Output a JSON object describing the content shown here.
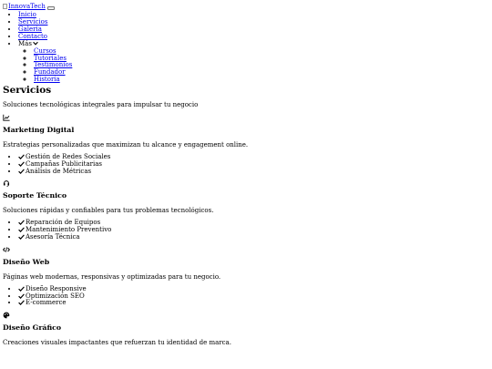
{
  "header": {
    "logo_alt": "InnovaTech"
  },
  "nav": {
    "items": [
      "Inicio",
      "Servicios",
      "Galeria",
      "Contacto"
    ],
    "more_label": "Más",
    "more_items": [
      "Cursos",
      "Tutoriales",
      "Testimonios",
      "Fundador",
      "Historia"
    ]
  },
  "main": {
    "title": "Servicios",
    "subtitle": "Soluciones tecnológicas integrales para impulsar tu negocio",
    "services": [
      {
        "icon": "chart-line-icon",
        "title": "Marketing Digital",
        "description": "Estrategias personalizadas que maximizan tu alcance y engagement online.",
        "features": [
          "Gestión de Redes Sociales",
          "Campañas Publicitarias",
          "Análisis de Métricas"
        ]
      },
      {
        "icon": "headset-icon",
        "title": "Soporte Técnico",
        "description": "Soluciones rápidas y confiables para tus problemas tecnológicos.",
        "features": [
          "Reparación de Equipos",
          "Mantenimiento Preventivo",
          "Asesoría Técnica"
        ]
      },
      {
        "icon": "code-icon",
        "title": "Diseño Web",
        "description": "Páginas web modernas, responsivas y optimizadas para tu negocio.",
        "features": [
          "Diseño Responsive",
          "Optimización SEO",
          "E-commerce"
        ]
      },
      {
        "icon": "palette-icon",
        "title": "Diseño Gráfico",
        "description": "Creaciones visuales impactantes que refuerzan tu identidad de marca.",
        "features": []
      }
    ]
  },
  "colors": {
    "link": "#0000ee",
    "text": "#000000",
    "background": "#ffffff"
  }
}
